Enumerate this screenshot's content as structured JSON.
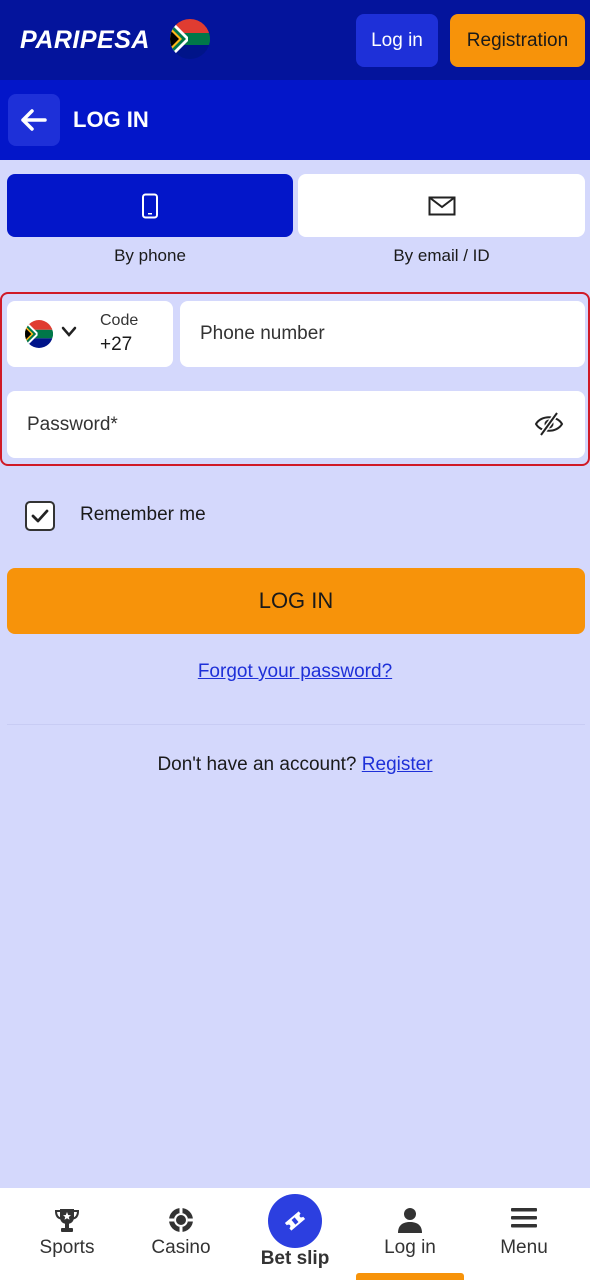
{
  "header": {
    "brand": "PARIPESA",
    "login_label": "Log in",
    "register_label": "Registration"
  },
  "subheader": {
    "title": "LOG IN"
  },
  "tabs": [
    {
      "label": "By phone",
      "icon": "phone-icon",
      "active": true
    },
    {
      "label": "By email / ID",
      "icon": "envelope-icon",
      "active": false
    }
  ],
  "form": {
    "code_label": "Code",
    "code_value": "+27",
    "phone_placeholder": "Phone number",
    "password_placeholder": "Password*",
    "remember_label": "Remember me",
    "remember_checked": true,
    "submit_label": "LOG IN",
    "forgot_label": "Forgot your password?",
    "no_account_text": "Don't have an account?",
    "register_link": "Register"
  },
  "bottom_nav": [
    {
      "label": "Sports",
      "icon": "trophy-icon"
    },
    {
      "label": "Casino",
      "icon": "casino-chip-icon"
    },
    {
      "label": "Bet slip",
      "icon": "ticket-icon"
    },
    {
      "label": "Log in",
      "icon": "user-icon",
      "active": true
    },
    {
      "label": "Menu",
      "icon": "menu-icon"
    }
  ],
  "colors": {
    "header_bg": "#04149c",
    "subheader_bg": "#0316c9",
    "accent_orange": "#f7930a",
    "page_bg": "#d4d8fc",
    "highlight_border": "#d01a26"
  }
}
